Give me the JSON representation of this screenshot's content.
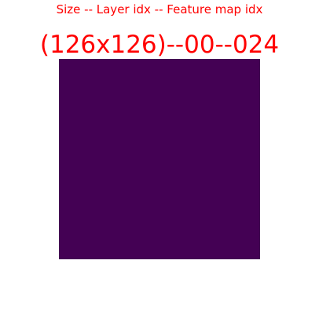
{
  "caption": "Size -- Layer idx -- Feature map idx",
  "identifier": "(126x126)--00--024",
  "feature_map": {
    "fill_color": "#440154"
  },
  "colors": {
    "text": "#ff0000",
    "background": "#ffffff"
  }
}
